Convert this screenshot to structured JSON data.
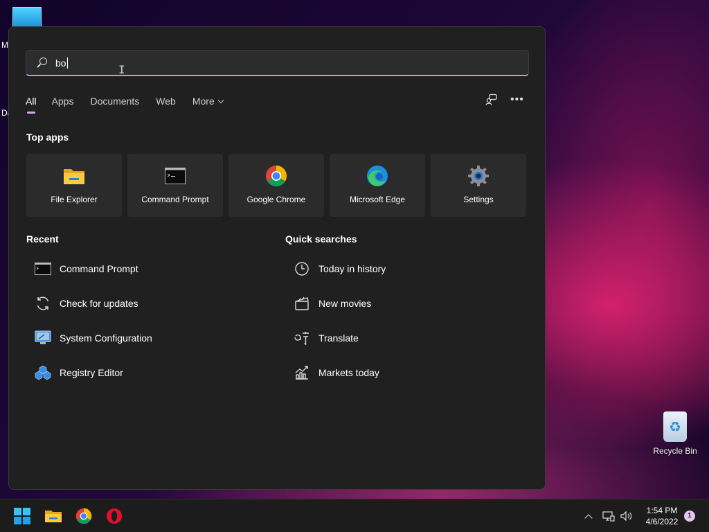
{
  "desktop": {
    "fragment_1": "M",
    "fragment_2": "Da",
    "recycle_bin_label": "Recycle Bin"
  },
  "search": {
    "query": "bo"
  },
  "tabs": [
    {
      "label": "All",
      "active": true
    },
    {
      "label": "Apps"
    },
    {
      "label": "Documents"
    },
    {
      "label": "Web"
    },
    {
      "label": "More"
    }
  ],
  "top_apps": {
    "title": "Top apps",
    "items": [
      {
        "label": "File Explorer",
        "icon": "folder-icon"
      },
      {
        "label": "Command Prompt",
        "icon": "terminal-icon"
      },
      {
        "label": "Google Chrome",
        "icon": "chrome-icon"
      },
      {
        "label": "Microsoft Edge",
        "icon": "edge-icon"
      },
      {
        "label": "Settings",
        "icon": "gear-icon"
      }
    ]
  },
  "recent": {
    "title": "Recent",
    "items": [
      {
        "label": "Command Prompt",
        "icon": "terminal-icon"
      },
      {
        "label": "Check for updates",
        "icon": "refresh-icon"
      },
      {
        "label": "System Configuration",
        "icon": "system-config-icon"
      },
      {
        "label": "Registry Editor",
        "icon": "registry-icon"
      }
    ]
  },
  "quick_searches": {
    "title": "Quick searches",
    "items": [
      {
        "label": "Today in history",
        "icon": "clock-icon"
      },
      {
        "label": "New movies",
        "icon": "clapperboard-icon"
      },
      {
        "label": "Translate",
        "icon": "translate-icon"
      },
      {
        "label": "Markets today",
        "icon": "chart-icon"
      }
    ]
  },
  "taskbar": {
    "time": "1:54 PM",
    "date": "4/6/2022",
    "notification_count": "1"
  },
  "colors": {
    "panel_bg": "#202020",
    "tile_bg": "#2b2b2b",
    "accent": "#c39be0"
  }
}
